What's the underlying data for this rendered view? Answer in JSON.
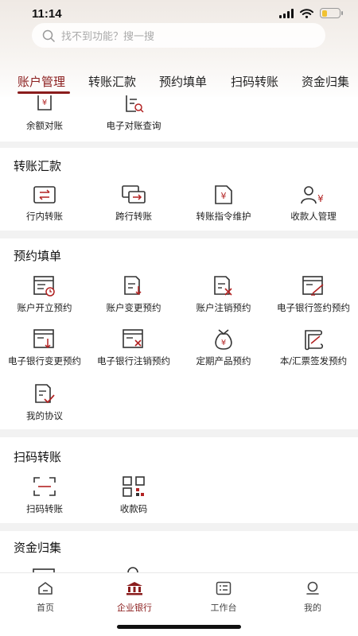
{
  "status": {
    "time": "11:14"
  },
  "search": {
    "placeholder": "找不到功能？搜一搜"
  },
  "tabs": [
    {
      "label": "账户管理",
      "active": true
    },
    {
      "label": "转账汇款"
    },
    {
      "label": "预约填单"
    },
    {
      "label": "扫码转账"
    },
    {
      "label": "资金归集"
    }
  ],
  "account": {
    "items": [
      {
        "label": "余额对账",
        "icon": "balance-check-icon"
      },
      {
        "label": "电子对账查询",
        "icon": "e-statement-query-icon"
      }
    ]
  },
  "transfer": {
    "title": "转账汇款",
    "items": [
      {
        "label": "行内转账",
        "icon": "intra-bank-transfer-icon"
      },
      {
        "label": "跨行转账",
        "icon": "inter-bank-transfer-icon"
      },
      {
        "label": "转账指令维护",
        "icon": "transfer-instruction-icon"
      },
      {
        "label": "收款人管理",
        "icon": "payee-management-icon"
      }
    ]
  },
  "reservation": {
    "title": "预约填单",
    "items": [
      {
        "label": "账户开立预约",
        "icon": "account-open-icon"
      },
      {
        "label": "账户变更预约",
        "icon": "account-change-icon"
      },
      {
        "label": "账户注销预约",
        "icon": "account-close-icon"
      },
      {
        "label": "电子银行签约预约",
        "icon": "ebank-sign-icon"
      },
      {
        "label": "电子银行变更预约",
        "icon": "ebank-change-icon"
      },
      {
        "label": "电子银行注销预约",
        "icon": "ebank-cancel-icon"
      },
      {
        "label": "定期产品预约",
        "icon": "money-bag-icon"
      },
      {
        "label": "本/汇票签发预约",
        "icon": "draft-issue-icon"
      },
      {
        "label": "我的协议",
        "icon": "my-agreement-icon"
      }
    ]
  },
  "scan": {
    "title": "扫码转账",
    "items": [
      {
        "label": "扫码转账",
        "icon": "scan-icon"
      },
      {
        "label": "收款码",
        "icon": "qr-code-icon"
      }
    ]
  },
  "pooling": {
    "title": "资金归集"
  },
  "bottom_nav": [
    {
      "label": "首页",
      "icon": "home-icon"
    },
    {
      "label": "企业银行",
      "icon": "bank-icon",
      "active": true
    },
    {
      "label": "工作台",
      "icon": "workbench-icon"
    },
    {
      "label": "我的",
      "icon": "profile-icon"
    }
  ],
  "colors": {
    "accent": "#8a1c1c",
    "icon_stroke": "#333333",
    "icon_red": "#b22222",
    "background": "#f2f2f2"
  }
}
